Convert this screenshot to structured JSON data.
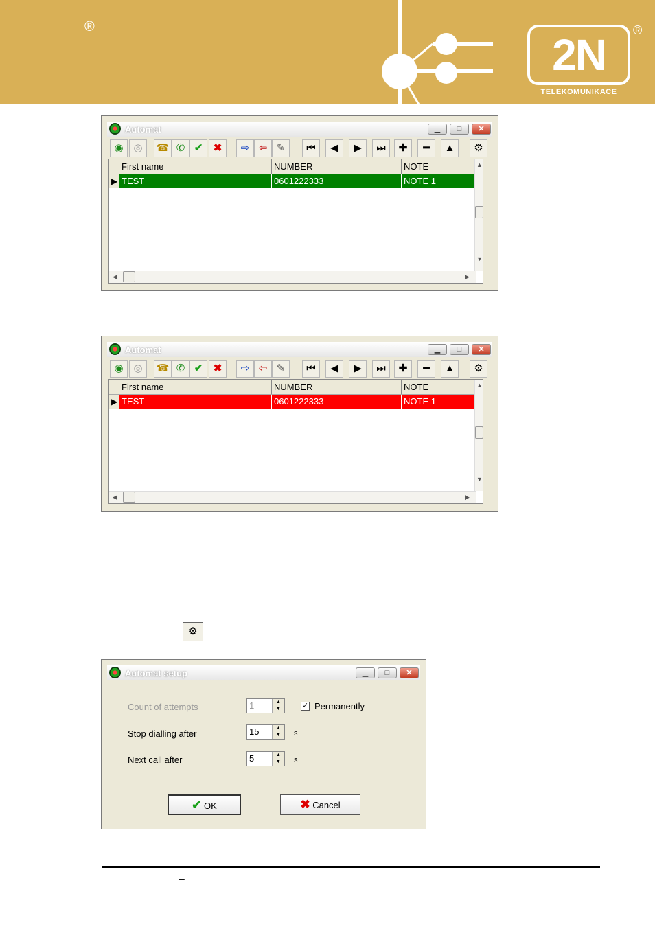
{
  "header": {
    "registered_mark": "®",
    "logo_text": "2N",
    "logo_registered": "®",
    "company": "TELEKOMUNIKACE",
    "brand_color": "#d9b056"
  },
  "windows": [
    {
      "title": "Automat",
      "columns": [
        "First name",
        "NUMBER",
        "NOTE"
      ],
      "row": {
        "first_name": "TEST",
        "number": "0601222333",
        "note": "NOTE 1"
      },
      "row_color": "#008000"
    },
    {
      "title": "Automat",
      "columns": [
        "First name",
        "NUMBER",
        "NOTE"
      ],
      "row": {
        "first_name": "TEST",
        "number": "0601222333",
        "note": "NOTE 1"
      },
      "row_color": "#ff0000"
    }
  ],
  "toolbar_icons": [
    "start-icon",
    "stop-icon",
    "phone-icon",
    "handset-icon",
    "check-icon",
    "cross-icon",
    "export-icon",
    "import-icon",
    "speaker-icon",
    "first-icon",
    "prior-icon",
    "next-icon",
    "last-icon",
    "plus-icon",
    "minus-icon",
    "up-icon",
    "setup-icon"
  ],
  "setup_dialog": {
    "title": "Automat setup",
    "count_label": "Count of attempts",
    "count_value": "1",
    "permanently_label": "Permanently",
    "permanently_checked": true,
    "stop_label": "Stop dialling after",
    "stop_value": "15",
    "stop_unit": "s",
    "next_label": "Next call after",
    "next_value": "5",
    "next_unit": "s",
    "ok_label": "OK",
    "cancel_label": "Cancel"
  },
  "footer_mark": "–"
}
